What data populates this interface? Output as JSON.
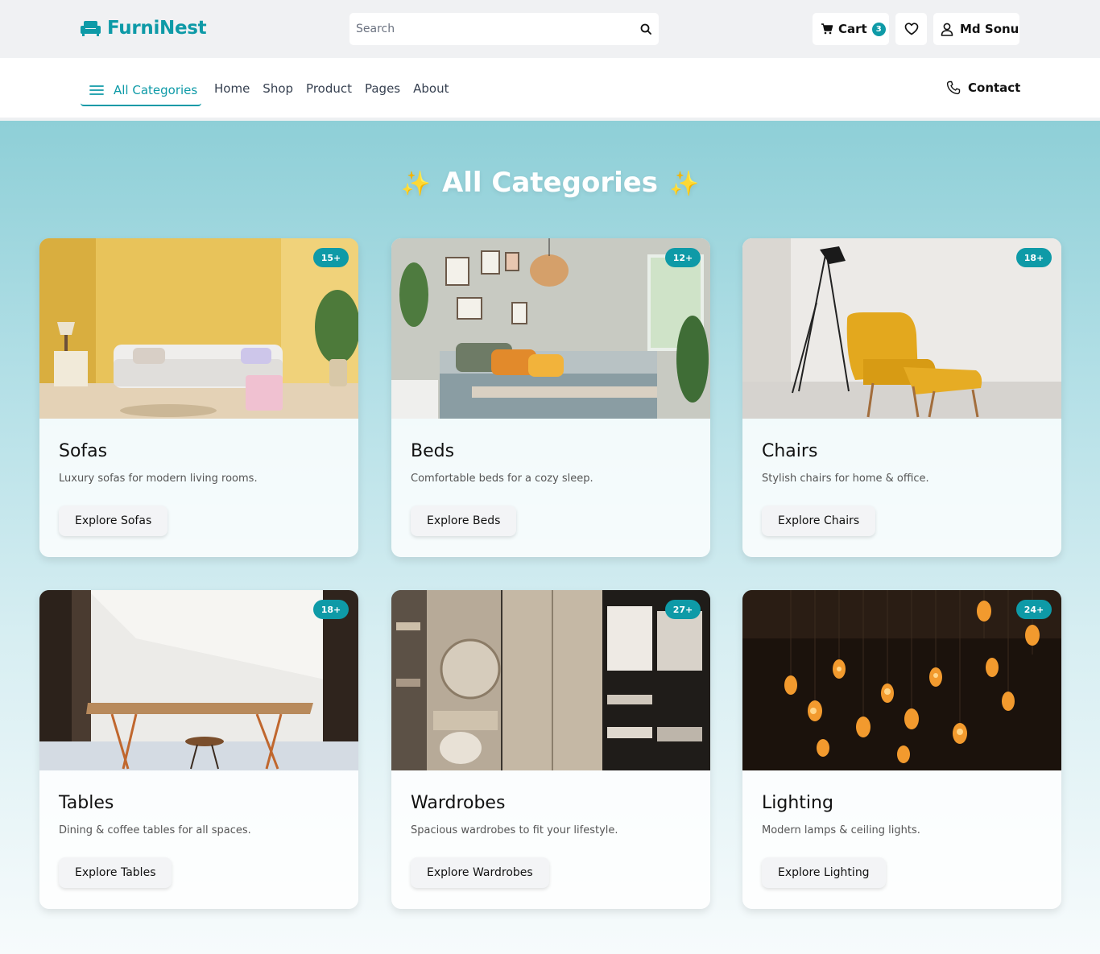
{
  "header": {
    "logo_text": "FurniNest",
    "search_placeholder": "Search",
    "cart_label": "Cart",
    "cart_count": "3",
    "user_name": "Md Sonu"
  },
  "nav": {
    "all_categories_label": "All Categories",
    "links": [
      "Home",
      "Shop",
      "Product",
      "Pages",
      "About"
    ],
    "contact_label": "Contact"
  },
  "main": {
    "title": "All Categories",
    "categories": [
      {
        "title": "Sofas",
        "description": "Luxury sofas for modern living rooms.",
        "badge": "15+",
        "button": "Explore Sofas"
      },
      {
        "title": "Beds",
        "description": "Comfortable beds for a cozy sleep.",
        "badge": "12+",
        "button": "Explore Beds"
      },
      {
        "title": "Chairs",
        "description": "Stylish chairs for home & office.",
        "badge": "18+",
        "button": "Explore Chairs"
      },
      {
        "title": "Tables",
        "description": "Dining & coffee tables for all spaces.",
        "badge": "18+",
        "button": "Explore Tables"
      },
      {
        "title": "Wardrobes",
        "description": "Spacious wardrobes to fit your lifestyle.",
        "badge": "27+",
        "button": "Explore Wardrobes"
      },
      {
        "title": "Lighting",
        "description": "Modern lamps & ceiling lights.",
        "badge": "24+",
        "button": "Explore Lighting"
      }
    ]
  },
  "colors": {
    "brand": "#0e9aa7",
    "accent_sparkle": "#f7b63f"
  }
}
